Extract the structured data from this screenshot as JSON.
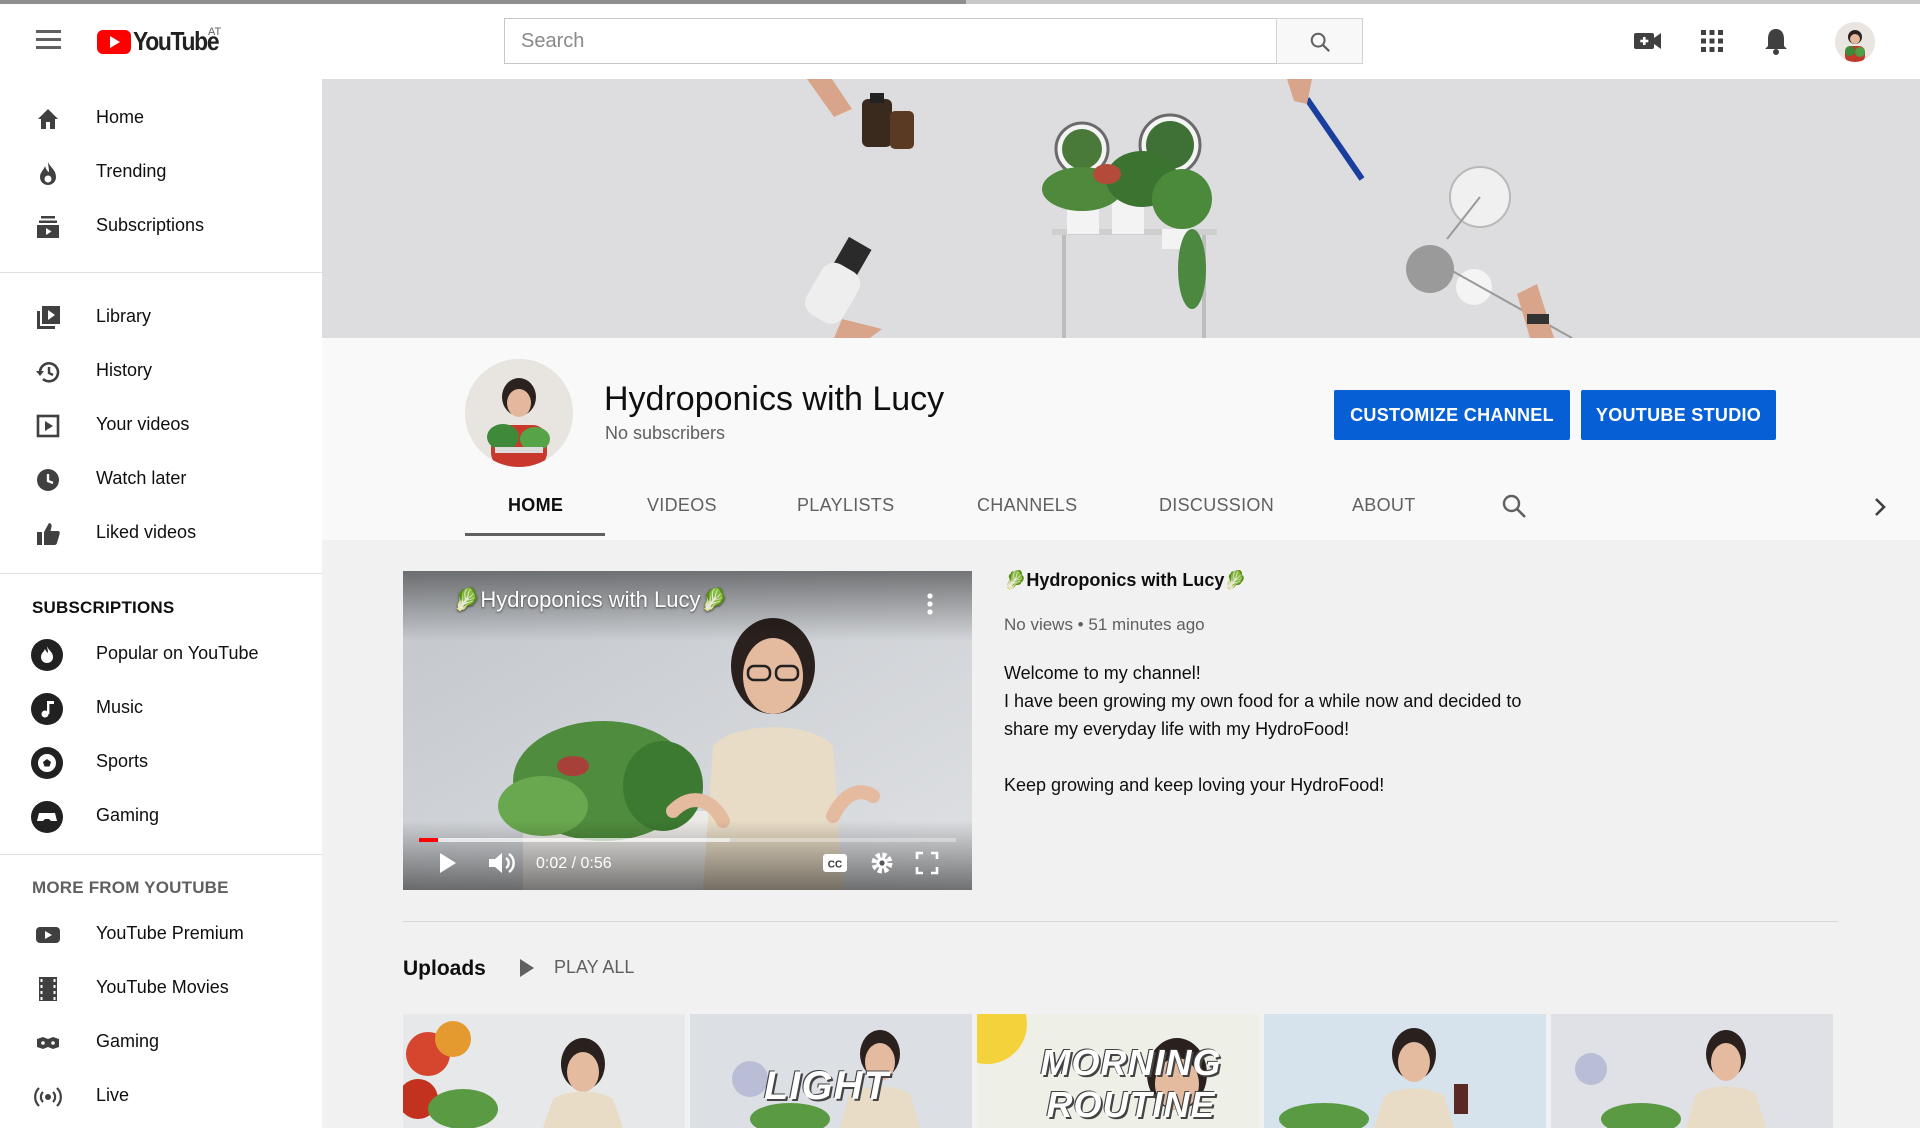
{
  "header": {
    "logo_text": "YouTube",
    "region": "AT",
    "search_placeholder": "Search"
  },
  "sidebar": {
    "main": [
      {
        "label": "Home",
        "icon": "home-icon"
      },
      {
        "label": "Trending",
        "icon": "trending-icon"
      },
      {
        "label": "Subscriptions",
        "icon": "subscriptions-icon"
      }
    ],
    "library": [
      {
        "label": "Library",
        "icon": "library-icon"
      },
      {
        "label": "History",
        "icon": "history-icon"
      },
      {
        "label": "Your videos",
        "icon": "your-videos-icon"
      },
      {
        "label": "Watch later",
        "icon": "watch-later-icon"
      },
      {
        "label": "Liked videos",
        "icon": "liked-videos-icon"
      }
    ],
    "subscriptions_heading": "SUBSCRIPTIONS",
    "subscriptions": [
      {
        "label": "Popular on YouTube",
        "icon": "popular-icon"
      },
      {
        "label": "Music",
        "icon": "music-icon"
      },
      {
        "label": "Sports",
        "icon": "sports-icon"
      },
      {
        "label": "Gaming",
        "icon": "gaming-icon"
      }
    ],
    "more_heading": "MORE FROM YOUTUBE",
    "more": [
      {
        "label": "YouTube Premium",
        "icon": "premium-icon"
      },
      {
        "label": "YouTube Movies",
        "icon": "movies-icon"
      },
      {
        "label": "Gaming",
        "icon": "gaming-icon"
      },
      {
        "label": "Live",
        "icon": "live-icon"
      }
    ]
  },
  "channel": {
    "name": "Hydroponics with Lucy",
    "subscribers": "No subscribers",
    "customize_label": "CUSTOMIZE CHANNEL",
    "studio_label": "YOUTUBE STUDIO",
    "tabs": [
      "HOME",
      "VIDEOS",
      "PLAYLISTS",
      "CHANNELS",
      "DISCUSSION",
      "ABOUT"
    ],
    "active_tab": "HOME"
  },
  "featured": {
    "overlay_title": "🥬Hydroponics with Lucy🥬",
    "title": "🥬Hydroponics with Lucy🥬",
    "meta": "No views • 51 minutes ago",
    "time": "0:02 / 0:56",
    "progress_fraction": 0.036,
    "buffered_fraction": 0.58,
    "description": [
      "Welcome to my channel!",
      "I have been growing my own food for a while now and decided to",
      "share my everyday life with my HydroFood!",
      "",
      "Keep growing and keep loving your HydroFood!"
    ]
  },
  "uploads": {
    "title": "Uploads",
    "play_all": "PLAY ALL",
    "thumbnails": [
      {
        "overlay": ""
      },
      {
        "overlay": "LIGHT"
      },
      {
        "overlay": "MORNING ROUTINE"
      },
      {
        "overlay": ""
      },
      {
        "overlay": ""
      }
    ]
  },
  "colors": {
    "brand_red": "#ff0000",
    "button_blue": "#065fd4"
  }
}
